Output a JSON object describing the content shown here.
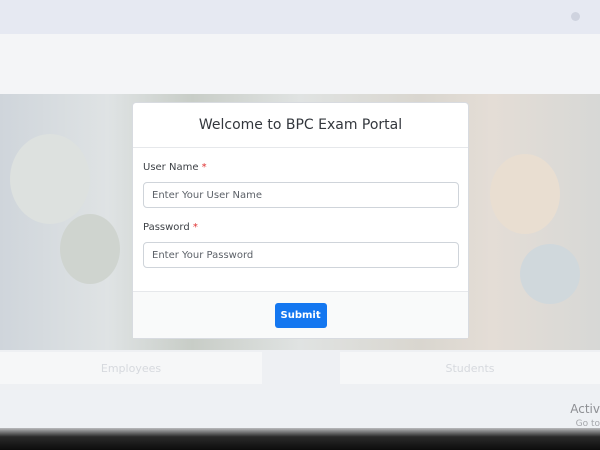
{
  "login": {
    "title": "Welcome to BPC Exam Portal",
    "username": {
      "label": "User Name",
      "required_mark": "*",
      "placeholder": "Enter Your User Name",
      "value": ""
    },
    "password": {
      "label": "Password",
      "required_mark": "*",
      "placeholder": "Enter Your Password",
      "value": ""
    },
    "submit_label": "Submit"
  },
  "background": {
    "cards": [
      "Employees",
      "Students"
    ],
    "windows_watermark": {
      "title": "Activ",
      "subtitle": "Go to"
    }
  },
  "colors": {
    "primary_button": "#1477f0",
    "required_mark": "#e03131"
  },
  "icons": {
    "topbar_user": "user-icon"
  }
}
